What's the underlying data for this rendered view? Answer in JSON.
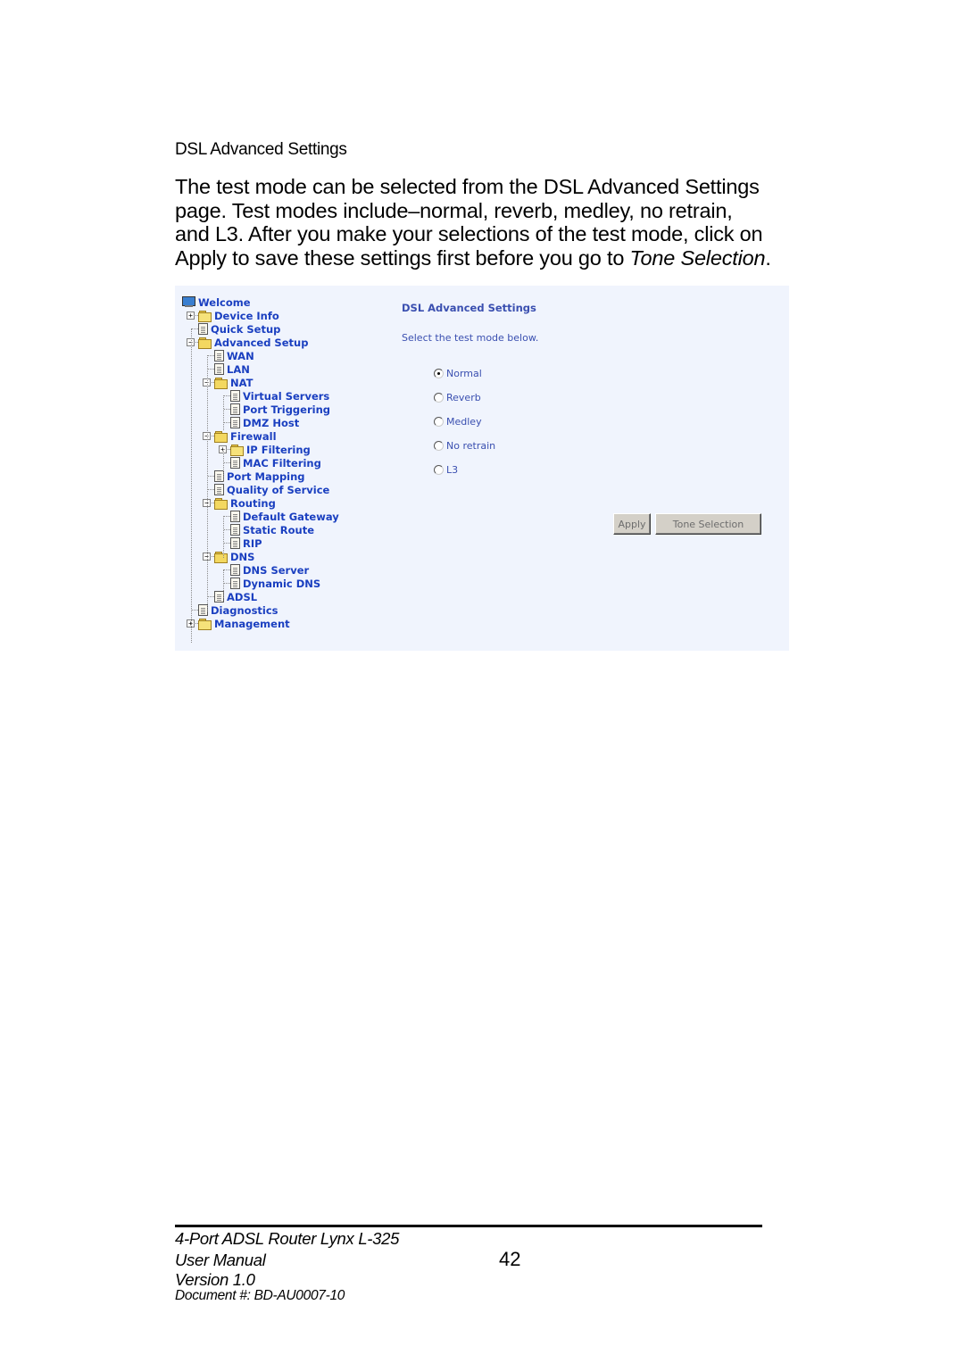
{
  "section_title": "DSL Advanced Settings",
  "paragraph": {
    "line1": "The test mode can be selected from the DSL Advanced Settings",
    "line2": "page.  Test modes include–normal, reverb, medley, no retrain,",
    "line3": "and L3.  After you make your selections of the test mode, click on",
    "apply_word": "Apply",
    "line4_mid": " to save these settings first before you go to ",
    "tone_selection_italic": "Tone Selection",
    "line4_end": "."
  },
  "screenshot": {
    "tree": [
      {
        "label": "Welcome",
        "icon": "monitor-icon"
      },
      {
        "label": "Device Info",
        "icon": "folder-icon",
        "expander": "+"
      },
      {
        "label": "Quick Setup",
        "icon": "document-icon"
      },
      {
        "label": "Advanced Setup",
        "icon": "folder-open-icon",
        "expander": "-"
      },
      {
        "label": "WAN",
        "icon": "document-icon"
      },
      {
        "label": "LAN",
        "icon": "document-icon"
      },
      {
        "label": "NAT",
        "icon": "folder-open-icon",
        "expander": "-"
      },
      {
        "label": "Virtual Servers",
        "icon": "document-icon"
      },
      {
        "label": "Port Triggering",
        "icon": "document-icon"
      },
      {
        "label": "DMZ Host",
        "icon": "document-icon"
      },
      {
        "label": "Firewall",
        "icon": "folder-open-icon",
        "expander": "-"
      },
      {
        "label": "IP Filtering",
        "icon": "folder-icon",
        "expander": "+"
      },
      {
        "label": "MAC Filtering",
        "icon": "document-icon"
      },
      {
        "label": "Port Mapping",
        "icon": "document-icon"
      },
      {
        "label": "Quality of Service",
        "icon": "document-icon"
      },
      {
        "label": "Routing",
        "icon": "folder-open-icon",
        "expander": "-"
      },
      {
        "label": "Default Gateway",
        "icon": "document-icon"
      },
      {
        "label": "Static Route",
        "icon": "document-icon"
      },
      {
        "label": "RIP",
        "icon": "document-icon"
      },
      {
        "label": "DNS",
        "icon": "folder-open-icon",
        "expander": "-"
      },
      {
        "label": "DNS Server",
        "icon": "document-icon"
      },
      {
        "label": "Dynamic DNS",
        "icon": "document-icon"
      },
      {
        "label": "ADSL",
        "icon": "document-icon"
      },
      {
        "label": "Diagnostics",
        "icon": "document-icon"
      },
      {
        "label": "Management",
        "icon": "folder-icon",
        "expander": "+"
      }
    ],
    "panel": {
      "title": "DSL Advanced Settings",
      "subtitle": "Select the test mode below.",
      "test_modes": [
        {
          "label": "Normal",
          "checked": true
        },
        {
          "label": "Reverb",
          "checked": false
        },
        {
          "label": "Medley",
          "checked": false
        },
        {
          "label": "No retrain",
          "checked": false
        },
        {
          "label": "L3",
          "checked": false
        }
      ],
      "apply_label": "Apply",
      "tone_selection_label": "Tone Selection"
    }
  },
  "footer": {
    "product": "4-Port ADSL Router Lynx L-325",
    "manual": "User Manual",
    "version": "Version 1.0",
    "document": "Document #:  BD-AU0007-10",
    "page_number": "42"
  }
}
